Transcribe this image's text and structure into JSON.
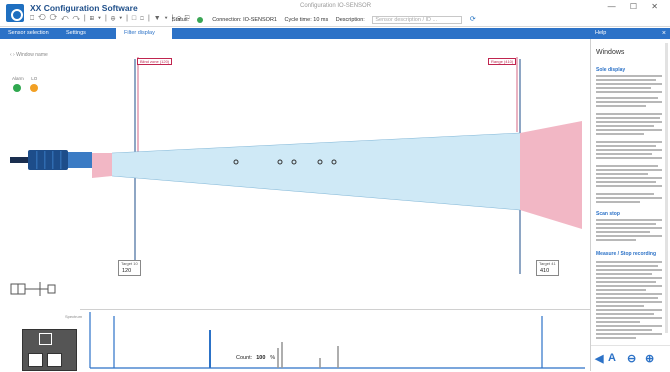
{
  "app": {
    "title": "XX Configuration Software",
    "window_title": "Configuration IO-SENSOR",
    "quick_toolbar": "⎕ ⟲ ⟳ ↶ ↷ | ⊞ ▾ | ⊕ ▾ | □ ◻ | ▼ ▾ | ⚲ ⚐",
    "window_controls": "— ☐ ✕"
  },
  "statusline": {
    "mode": "Status:",
    "connected": "Connection: IO-SENSOR1",
    "cycle": "Cycle time: 10 ms",
    "description_label": "Description:",
    "description_placeholder": "Sensor description / ID ..."
  },
  "tabs": [
    {
      "label": "Sensor selection"
    },
    {
      "label": "Settings"
    },
    {
      "label": "Filter display"
    }
  ],
  "help": {
    "tab_label": "Help",
    "title": "Windows",
    "headings": [
      "Sole display",
      "Scan stop",
      "Measure / Stop recording"
    ],
    "footer_buttons": [
      "◀",
      "A",
      "⊖",
      "⊕"
    ]
  },
  "breadcrumb": "‹  ›  Window name",
  "leds": {
    "labels": [
      "Alarm",
      "LO"
    ],
    "colors": [
      "#2fa84f",
      "#f2a024"
    ]
  },
  "limits": {
    "left_label": "Blind zone (120)",
    "right_label": "Range (410)",
    "left_box": {
      "caption": "Target 10",
      "value": "120"
    },
    "right_box": {
      "caption": "Target 41",
      "value": "410"
    }
  },
  "graph": {
    "label": "Spectrum",
    "counter_label": "Count:",
    "counter_value": "100",
    "counter_unit": "%"
  },
  "colors": {
    "accent": "#2c72c7",
    "beam": "#cfe9f6",
    "blind": "#f2b7c5",
    "limit": "#c0254f",
    "sensor": "#1d4d8a"
  }
}
